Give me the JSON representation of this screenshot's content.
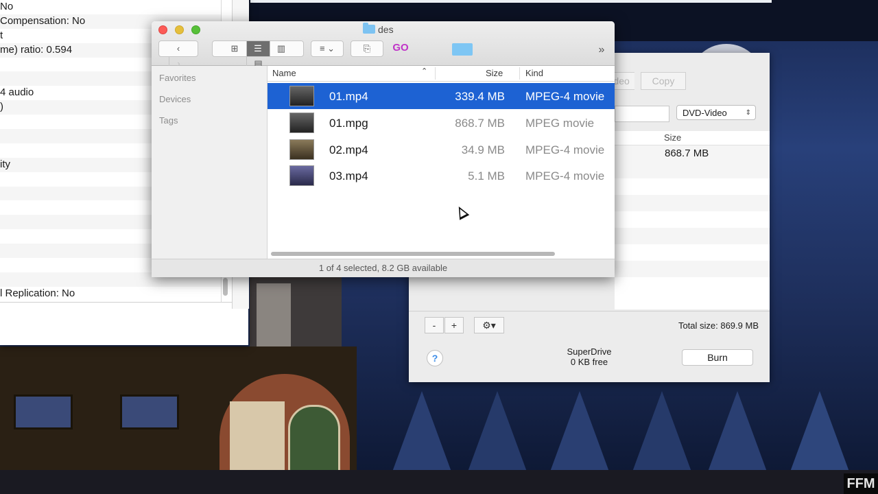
{
  "info_window": {
    "rows": [
      "No",
      " Compensation: No",
      "t",
      "me) ratio: 0.594",
      "",
      "",
      "4 audio",
      ")",
      "",
      "",
      "",
      "ity",
      "",
      "",
      "",
      "",
      "",
      "",
      "",
      "",
      "l Replication: No"
    ]
  },
  "finder": {
    "title": "des",
    "toolbar": {
      "back": "‹",
      "forward": "›",
      "view_icons": "⊞",
      "view_list": "☰",
      "view_columns": "▥",
      "view_coverflow": "▤",
      "arrange": "≡ ⌄",
      "action": "⎘",
      "go": "GO",
      "more": "»"
    },
    "sidebar": {
      "favorites": "Favorites",
      "devices": "Devices",
      "tags": "Tags"
    },
    "columns": {
      "name": "Name",
      "sort": "⌃",
      "size": "Size",
      "kind": "Kind"
    },
    "files": [
      {
        "name": "01.mp4",
        "size": "339.4 MB",
        "kind": "MPEG-4 movie"
      },
      {
        "name": "01.mpg",
        "size": "868.7 MB",
        "kind": "MPEG movie"
      },
      {
        "name": "02.mp4",
        "size": "34.9 MB",
        "kind": "MPEG-4 movie"
      },
      {
        "name": "03.mp4",
        "size": "5.1 MB",
        "kind": "MPEG-4 movie"
      }
    ],
    "status": "1 of 4 selected, 8.2 GB available"
  },
  "burn_window": {
    "seg_video": "Video",
    "seg_copy": "Copy",
    "format": "DVD-Video",
    "format_arrow": "⇕",
    "list_header_size": "Size",
    "list_row_size": "868.7 MB",
    "minus": "-",
    "plus": "+",
    "gear": "⚙▾",
    "total": "Total size: 869.9 MB",
    "help": "?",
    "drive_name": "SuperDrive",
    "drive_free": "0 KB free",
    "burn": "Burn"
  },
  "watermark": "FFM",
  "colors": {
    "selection": "#1d62d3",
    "go_accent": "#c034c8",
    "folder": "#7dc3f2"
  }
}
